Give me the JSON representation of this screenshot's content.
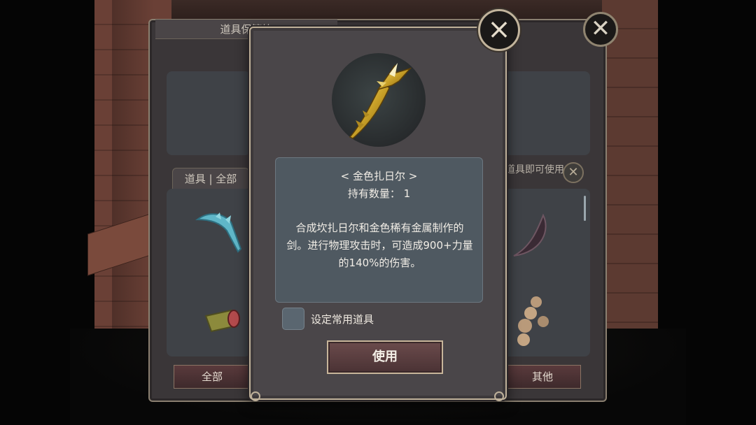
{
  "back_panel": {
    "title": "道具保管箱",
    "tab_label": "道具 | 全部",
    "hint_text": "道具即可使用",
    "bottom_left_button": "全部",
    "bottom_right_button": "其他"
  },
  "dialog": {
    "item_name": "< 金色扎日尔 >",
    "quantity_label": "持有数量： 1",
    "description": "合成坎扎日尔和金色稀有金属制作的剑。进行物理攻击时，可造成900+力量的140%的伤害。",
    "checkbox_label": "设定常用道具",
    "use_button": "使用",
    "close_icon": "×"
  },
  "icons": {
    "close": "close-icon",
    "item": "golden-blade-icon"
  },
  "colors": {
    "panel": "#4a4649",
    "desc_box": "#4f5961",
    "frame_gold": "#bfb19a",
    "button": "#5a3a3c"
  }
}
